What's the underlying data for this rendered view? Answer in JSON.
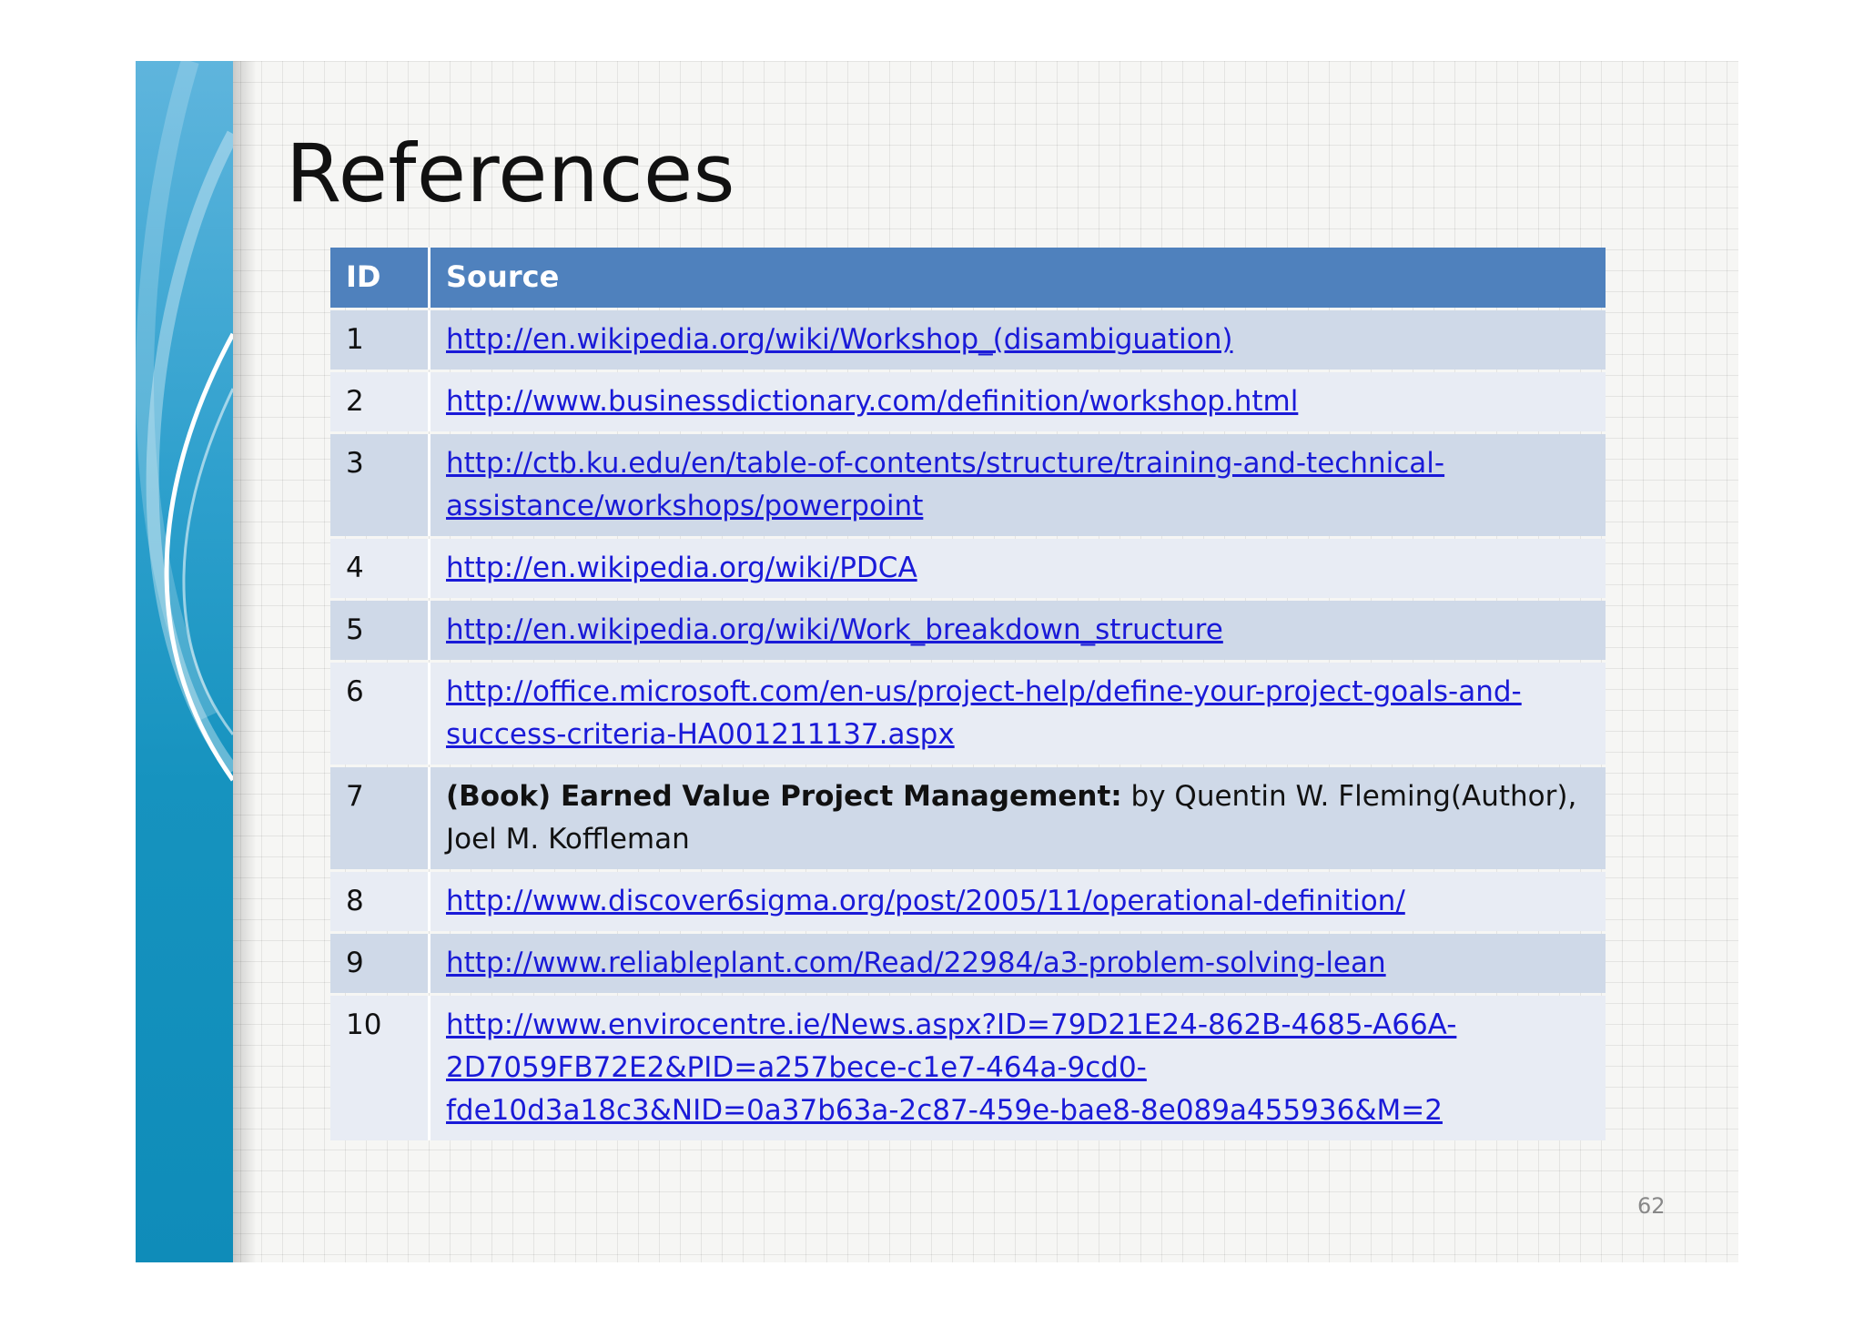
{
  "slide": {
    "title": "References",
    "page_number": "62"
  },
  "table": {
    "headers": {
      "id": "ID",
      "source": "Source"
    },
    "rows": [
      {
        "id": "1",
        "link": "http://en.wikipedia.org/wiki/Workshop_(disambiguation)"
      },
      {
        "id": "2",
        "link": "http://www.businessdictionary.com/definition/workshop.html"
      },
      {
        "id": "3",
        "link": "http://ctb.ku.edu/en/table-of-contents/structure/training-and-technical-assistance/workshops/powerpoint"
      },
      {
        "id": "4",
        "link": "http://en.wikipedia.org/wiki/PDCA"
      },
      {
        "id": "5",
        "link": "http://en.wikipedia.org/wiki/Work_breakdown_structure"
      },
      {
        "id": "6",
        "link": "http://office.microsoft.com/en-us/project-help/define-your-project-goals-and-success-criteria-HA001211137.aspx"
      },
      {
        "id": "7",
        "book_title": "(Book) Earned Value Project Management:",
        "book_rest": " by Quentin W. Fleming(Author), Joel M. Koffleman"
      },
      {
        "id": "8",
        "link": "http://www.discover6sigma.org/post/2005/11/operational-definition/"
      },
      {
        "id": "9",
        "link": "http://www.reliableplant.com/Read/22984/a3-problem-solving-lean"
      },
      {
        "id": "10",
        "link": "http://www.envirocentre.ie/News.aspx?ID=79D21E24-862B-4685-A66A-2D7059FB72E2&PID=a257bece-c1e7-464a-9cd0-fde10d3a18c3&NID=0a37b63a-2c87-459e-bae8-8e089a455936&M=2"
      }
    ]
  },
  "colors": {
    "header": "#4f81bd",
    "row_band_dark": "#cfd9e8",
    "row_band_light": "#e8ecf4",
    "link": "#1a1ad8",
    "side_band": "#1693bf"
  }
}
